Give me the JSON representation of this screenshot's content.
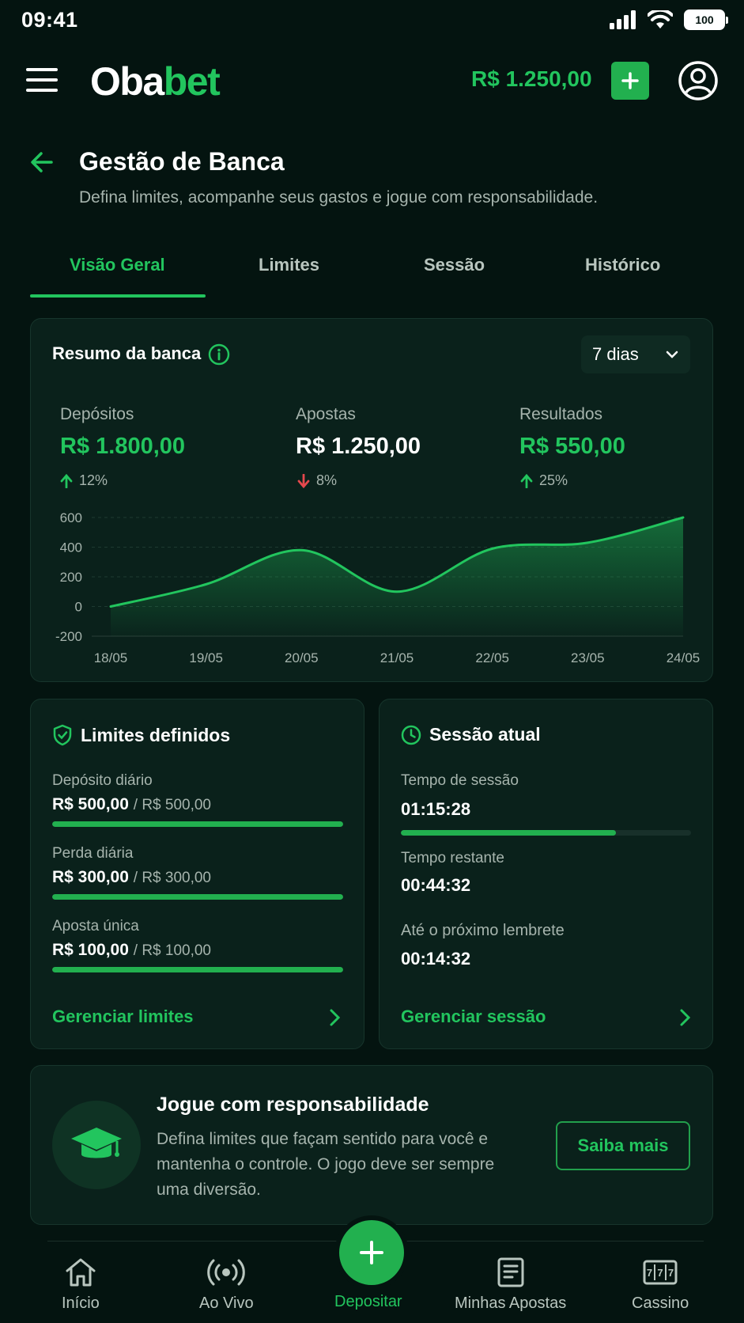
{
  "status_bar": {
    "time": "09:41",
    "battery": "100"
  },
  "header": {
    "logo_part1": "Oba",
    "logo_part2": "bet",
    "balance": "R$ 1.250,00"
  },
  "page": {
    "title": "Gestão de Banca",
    "subtitle": "Defina limites, acompanhe seus gastos e jogue com responsabilidade."
  },
  "tabs": [
    {
      "label": "Visão Geral",
      "active": true
    },
    {
      "label": "Limites",
      "active": false
    },
    {
      "label": "Sessão",
      "active": false
    },
    {
      "label": "Histórico",
      "active": false
    }
  ],
  "summary": {
    "title": "Resumo da banca",
    "period": "7 dias",
    "stats": [
      {
        "label": "Depósitos",
        "value": "R$ 1.800,00",
        "change": "12%",
        "direction": "up",
        "color": "#22c55e"
      },
      {
        "label": "Apostas",
        "value": "R$ 1.250,00",
        "change": "8%",
        "direction": "down",
        "color": "#ffffff"
      },
      {
        "label": "Resultados",
        "value": "R$ 550,00",
        "change": "25%",
        "direction": "up",
        "color": "#22c55e"
      }
    ]
  },
  "chart_data": {
    "type": "area",
    "x": [
      "18/05",
      "19/05",
      "20/05",
      "21/05",
      "22/05",
      "23/05",
      "24/05"
    ],
    "series": [
      {
        "values": [
          0,
          150,
          380,
          100,
          390,
          430,
          600
        ]
      }
    ],
    "yticks": [
      "600",
      "400",
      "200",
      "0",
      "-200"
    ],
    "ylim": [
      -200,
      600
    ],
    "grid": true,
    "color": "#22c55e"
  },
  "limits": {
    "title": "Limites definidos",
    "items": [
      {
        "label": "Depósito diário",
        "value": "R$ 500,00",
        "of": "/ R$ 500,00",
        "progress": 1.0
      },
      {
        "label": "Perda diária",
        "value": "R$ 300,00",
        "of": "/ R$ 300,00",
        "progress": 1.0
      },
      {
        "label": "Aposta única",
        "value": "R$ 100,00",
        "of": "/ R$ 100,00",
        "progress": 1.0
      }
    ],
    "link": "Gerenciar limites"
  },
  "session": {
    "title": "Sessão atual",
    "time_label": "Tempo de sessão",
    "time_value": "01:15:28",
    "progress": 0.74,
    "remaining_label": "Tempo restante",
    "remaining_value": "00:44:32",
    "reminder_label": "Até o próximo lembrete",
    "reminder_value": "00:14:32",
    "link": "Gerenciar sessão"
  },
  "responsible": {
    "title": "Jogue com responsabilidade",
    "text": "Defina limites que façam sentido para você e mantenha o controle. O jogo deve ser sempre uma diversão.",
    "button": "Saiba mais"
  },
  "bottom_nav": [
    {
      "label": "Início",
      "icon": "home-icon"
    },
    {
      "label": "Ao Vivo",
      "icon": "live-icon"
    },
    {
      "label": "Depositar",
      "icon": "plus-icon",
      "active": true
    },
    {
      "label": "Minhas Apostas",
      "icon": "bets-icon"
    },
    {
      "label": "Cassino",
      "icon": "slot-icon"
    }
  ]
}
